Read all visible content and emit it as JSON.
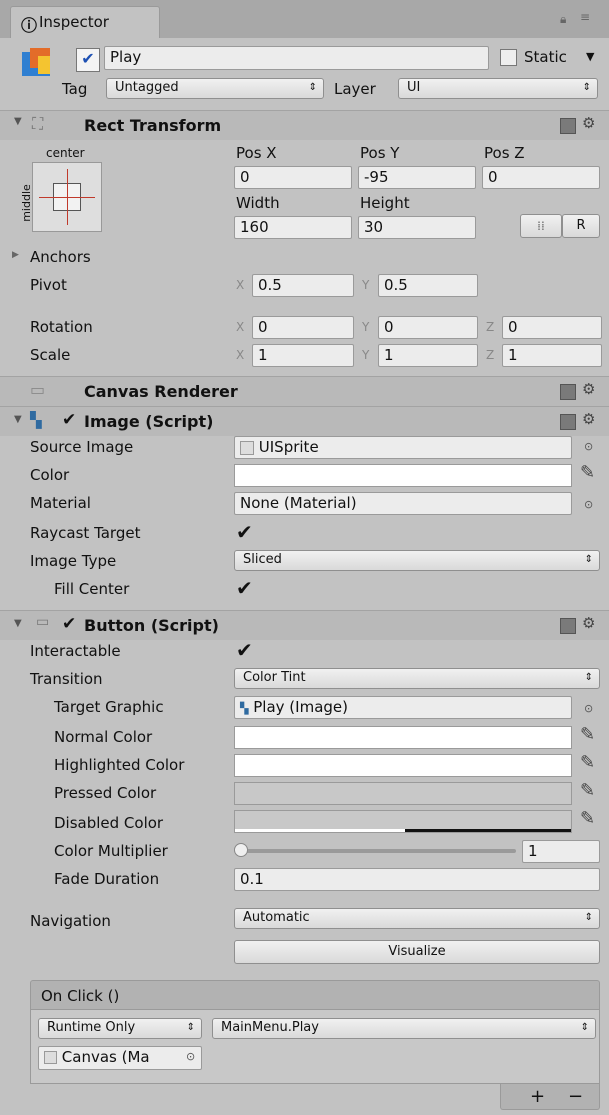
{
  "window": {
    "tab_title": "Inspector"
  },
  "object": {
    "name": "Play",
    "active": true,
    "static_label": "Static",
    "tag_label": "Tag",
    "tag_value": "Untagged",
    "layer_label": "Layer",
    "layer_value": "UI"
  },
  "rect_transform": {
    "title": "Rect Transform",
    "anchor_h": "center",
    "anchor_v": "middle",
    "pos_x_label": "Pos X",
    "pos_y_label": "Pos Y",
    "pos_z_label": "Pos Z",
    "pos_x": "0",
    "pos_y": "-95",
    "pos_z": "0",
    "width_label": "Width",
    "height_label": "Height",
    "width": "160",
    "height": "30",
    "raw_button": "R",
    "anchors_label": "Anchors",
    "pivot_label": "Pivot",
    "pivot_x": "0.5",
    "pivot_y": "0.5",
    "rotation_label": "Rotation",
    "rot_x": "0",
    "rot_y": "0",
    "rot_z": "0",
    "scale_label": "Scale",
    "scale_x": "1",
    "scale_y": "1",
    "scale_z": "1",
    "x": "X",
    "y": "Y",
    "z": "Z"
  },
  "canvas_renderer": {
    "title": "Canvas Renderer"
  },
  "image": {
    "title": "Image (Script)",
    "source_image_label": "Source Image",
    "source_image": "UISprite",
    "color_label": "Color",
    "material_label": "Material",
    "material": "None (Material)",
    "raycast_label": "Raycast Target",
    "image_type_label": "Image Type",
    "image_type": "Sliced",
    "fill_center_label": "Fill Center"
  },
  "button": {
    "title": "Button (Script)",
    "interactable_label": "Interactable",
    "transition_label": "Transition",
    "transition": "Color Tint",
    "target_graphic_label": "Target Graphic",
    "target_graphic": "Play (Image)",
    "normal_color_label": "Normal Color",
    "highlighted_color_label": "Highlighted Color",
    "pressed_color_label": "Pressed Color",
    "disabled_color_label": "Disabled Color",
    "color_multiplier_label": "Color Multiplier",
    "color_multiplier": "1",
    "fade_duration_label": "Fade Duration",
    "fade_duration": "0.1",
    "navigation_label": "Navigation",
    "navigation": "Automatic",
    "visualize_label": "Visualize",
    "on_click_label": "On Click ()",
    "runtime_option": "Runtime Only",
    "function": "MainMenu.Play",
    "target_object": "Canvas (Ma",
    "add_label": "+",
    "remove_label": "−"
  },
  "colors": {
    "pressed": "#c8c8c8",
    "disabled_bar": "#111111",
    "bg": "#c2c2c2"
  }
}
